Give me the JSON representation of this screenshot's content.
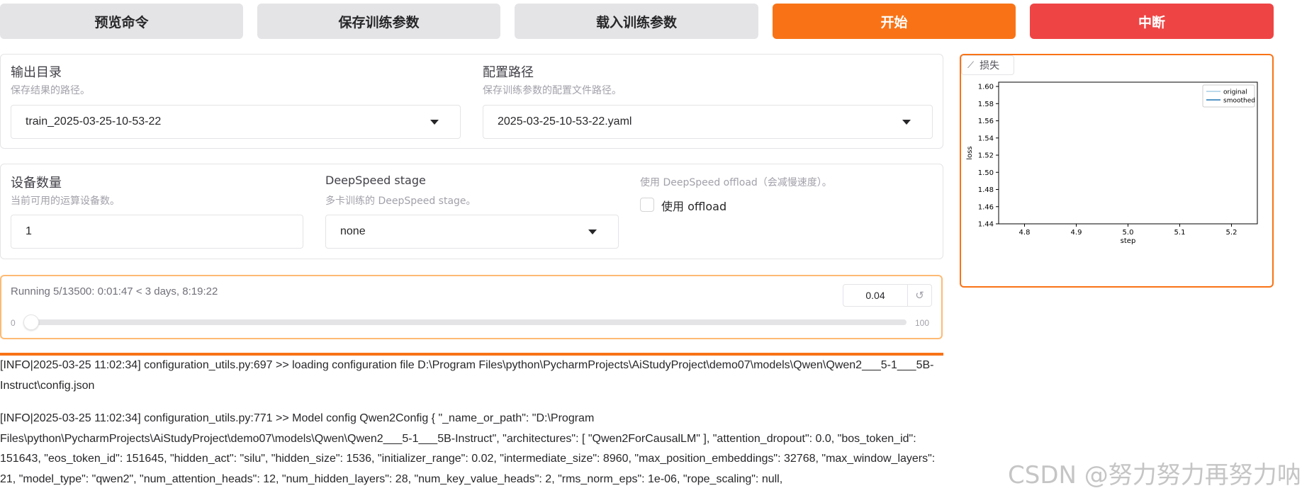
{
  "buttons": {
    "preview": "预览命令",
    "save": "保存训练参数",
    "load": "载入训练参数",
    "start": "开始",
    "abort": "中断"
  },
  "output_dir": {
    "label": "输出目录",
    "info": "保存结果的路径。",
    "value": "train_2025-03-25-10-53-22"
  },
  "config_path": {
    "label": "配置路径",
    "info": "保存训练参数的配置文件路径。",
    "value": "2025-03-25-10-53-22.yaml"
  },
  "device_count": {
    "label": "设备数量",
    "info": "当前可用的运算设备数。",
    "value": "1"
  },
  "ds_stage": {
    "label": "DeepSpeed stage",
    "info": "多卡训练的 DeepSpeed stage。",
    "value": "none"
  },
  "ds_offload": {
    "info": "使用 DeepSpeed offload（会减慢速度）。",
    "label": "使用 offload",
    "checked": false
  },
  "progress": {
    "status": "Running 5/13500: 0:01:47 < 3 days, 8:19:22",
    "value": "0.04",
    "min": "0",
    "max": "100",
    "fraction": 0.0004,
    "reset_icon": "reset-icon"
  },
  "logs": [
    "[INFO|2025-03-25 11:02:34] configuration_utils.py:697 >> loading configuration file D:\\Program Files\\python\\PycharmProjects\\AiStudyProject\\demo07\\models\\Qwen\\Qwen2___5-1___5B-Instruct\\config.json",
    "[INFO|2025-03-25 11:02:34] configuration_utils.py:771 >> Model config Qwen2Config { \"_name_or_path\": \"D:\\Program Files\\python\\PycharmProjects\\AiStudyProject\\demo07\\models\\Qwen\\Qwen2___5-1___5B-Instruct\", \"architectures\": [ \"Qwen2ForCausalLM\" ], \"attention_dropout\": 0.0, \"bos_token_id\": 151643, \"eos_token_id\": 151645, \"hidden_act\": \"silu\", \"hidden_size\": 1536, \"initializer_range\": 0.02, \"intermediate_size\": 8960, \"max_position_embeddings\": 32768, \"max_window_layers\": 21, \"model_type\": \"qwen2\", \"num_attention_heads\": 12, \"num_hidden_layers\": 28, \"num_key_value_heads\": 2, \"rms_norm_eps\": 1e-06, \"rope_scaling\": null,"
  ],
  "chart_tag": {
    "icon": "chart-icon",
    "label": "损失"
  },
  "chart_data": {
    "type": "line",
    "xlabel": "step",
    "ylabel": "loss",
    "xlim": [
      4.75,
      5.25
    ],
    "ylim": [
      1.44,
      1.605
    ],
    "x_ticks": [
      "4.8",
      "4.9",
      "5.0",
      "5.1",
      "5.2"
    ],
    "y_ticks": [
      "1.44",
      "1.46",
      "1.48",
      "1.50",
      "1.52",
      "1.54",
      "1.56",
      "1.58",
      "1.60"
    ],
    "legend_position": "top-right",
    "series": [
      {
        "name": "original",
        "color": "#a6cee3",
        "x": [],
        "y": []
      },
      {
        "name": "smoothed",
        "color": "#1f77b4",
        "x": [],
        "y": []
      }
    ]
  },
  "watermark": "CSDN @努力努力再努力呐"
}
